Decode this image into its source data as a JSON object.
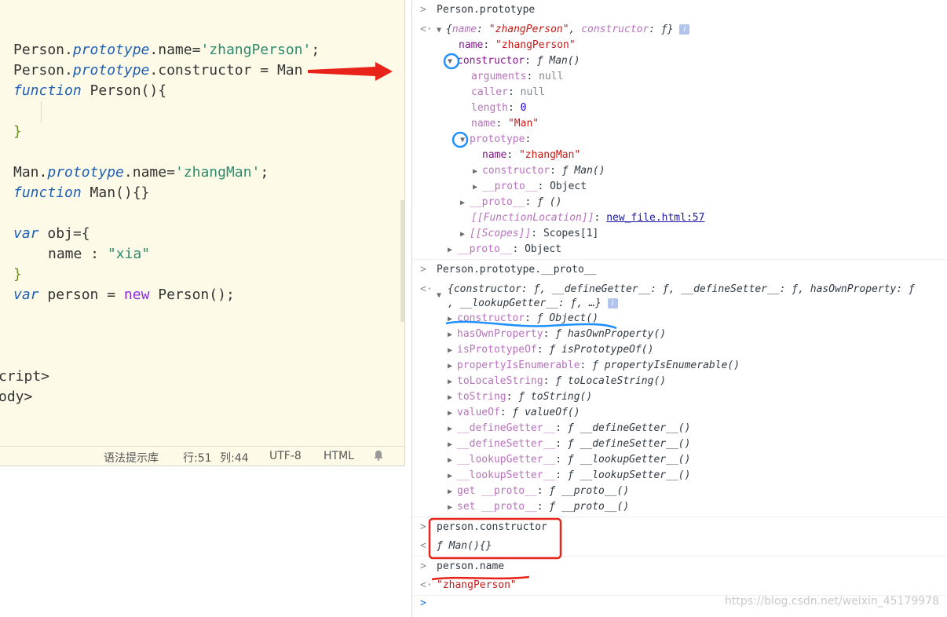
{
  "editor": {
    "lines": [
      [
        "Person.",
        "prototype",
        ".name=",
        "'zhangPerson'",
        ";"
      ],
      [
        "Person.",
        "prototype",
        ".constructor = Man"
      ],
      [
        "function",
        " Person(){"
      ],
      [
        "}"
      ],
      [
        "Man.",
        "prototype",
        ".name=",
        "'zhangMan'",
        ";"
      ],
      [
        "function",
        " Man(){}"
      ],
      [
        "var",
        " obj={"
      ],
      [
        "name : ",
        "\"xia\""
      ],
      [
        "}"
      ],
      [
        "var",
        " person = ",
        "new",
        " Person();"
      ],
      [
        "cript>"
      ],
      [
        "ody>"
      ]
    ],
    "status": {
      "hint_library": "语法提示库",
      "line": "行:51",
      "col": "列:44",
      "encoding": "UTF-8",
      "language": "HTML"
    }
  },
  "console": {
    "rows": {
      "c1_cmd": "Person.prototype",
      "c1_obj_name_key": "name",
      "c1_obj_name_val": "\"zhangPerson\"",
      "c1_obj_ctor_key": "constructor",
      "c1_obj_ctor_val": "ƒ",
      "name_key": "name",
      "name_val": "\"zhangPerson\"",
      "ctor_key": "constructor",
      "ctor_val": "ƒ Man()",
      "arguments_key": "arguments",
      "arguments_val": "null",
      "caller_key": "caller",
      "caller_val": "null",
      "length_key": "length",
      "length_val": "0",
      "fname_key": "name",
      "fname_val": "\"Man\"",
      "prototype_key": "prototype",
      "p_name_key": "name",
      "p_name_val": "\"zhangMan\"",
      "p_ctor_key": "constructor",
      "p_ctor_val": "ƒ Man()",
      "p_proto_key": "__proto__",
      "p_proto_val": "Object",
      "f_proto_key": "__proto__",
      "f_proto_val": "ƒ ()",
      "floc_key": "[[FunctionLocation]]",
      "floc_val": "new_file.html:57",
      "scopes_key": "[[Scopes]]",
      "scopes_val": "Scopes[1]",
      "o_proto_key": "__proto__",
      "o_proto_val": "Object",
      "c2_cmd": "Person.prototype.__proto__",
      "c2_summary1": "{constructor: ƒ, __defineGetter__: ƒ, __defineSetter__: ƒ, hasOwnProperty: ƒ",
      "c2_summary2": ", __lookupGetter__: ƒ, …}",
      "c2_items": [
        [
          "constructor",
          "ƒ Object()"
        ],
        [
          "hasOwnProperty",
          "ƒ hasOwnProperty()"
        ],
        [
          "isPrototypeOf",
          "ƒ isPrototypeOf()"
        ],
        [
          "propertyIsEnumerable",
          "ƒ propertyIsEnumerable()"
        ],
        [
          "toLocaleString",
          "ƒ toLocaleString()"
        ],
        [
          "toString",
          "ƒ toString()"
        ],
        [
          "valueOf",
          "ƒ valueOf()"
        ],
        [
          "__defineGetter__",
          "ƒ __defineGetter__()"
        ],
        [
          "__defineSetter__",
          "ƒ __defineSetter__()"
        ],
        [
          "__lookupGetter__",
          "ƒ __lookupGetter__()"
        ],
        [
          "__lookupSetter__",
          "ƒ __lookupSetter__()"
        ],
        [
          "get __proto__",
          "ƒ __proto__()"
        ],
        [
          "set __proto__",
          "ƒ __proto__()"
        ]
      ],
      "c3_cmd": "person.constructor",
      "c3_result": "ƒ Man(){}",
      "c4_cmd": "person.name",
      "c4_result": "\"zhangPerson\""
    },
    "info_icon": "i",
    "watermark": "https://blog.csdn.net/weixin_45179978"
  },
  "colors": {
    "editor_bg": "#fdfbe8",
    "keyword": "#1f5fb5",
    "string": "#2e8b6e",
    "console_key": "#881391",
    "console_string": "#c41a16",
    "annotation_red": "#e8231a",
    "annotation_blue": "#1e90ff"
  }
}
